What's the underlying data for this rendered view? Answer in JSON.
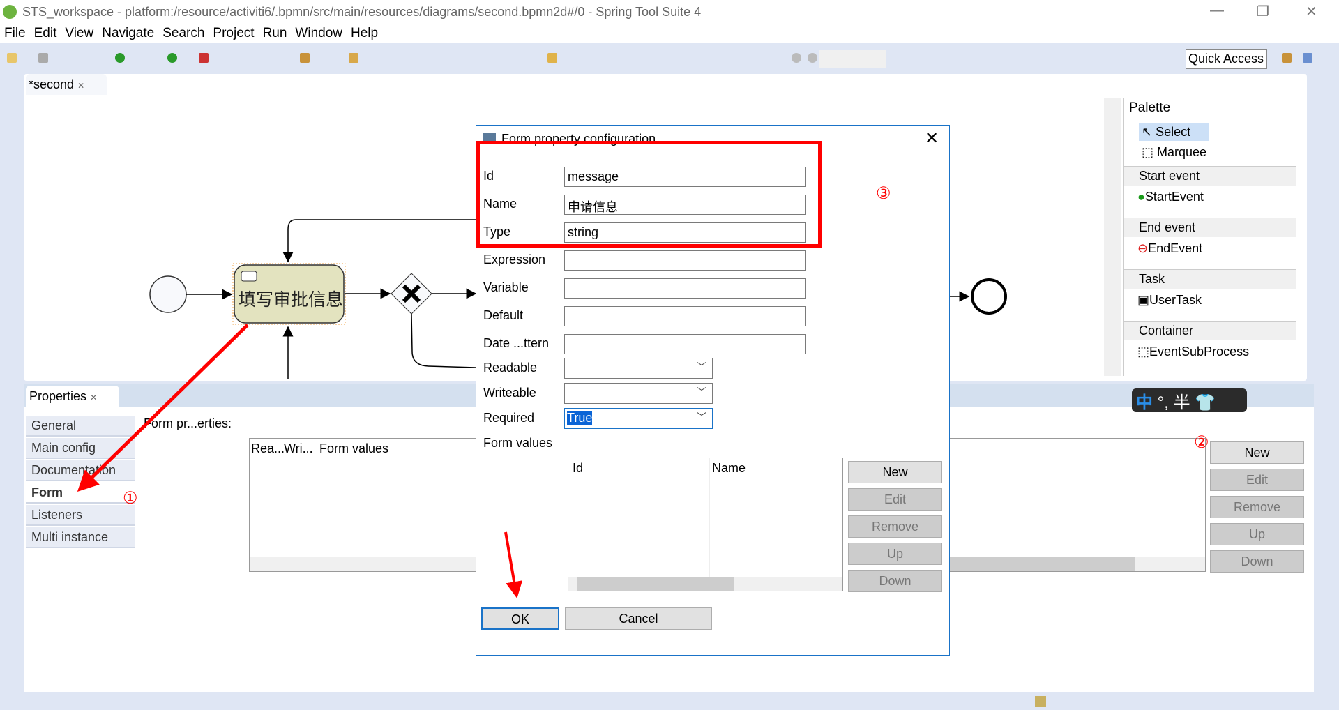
{
  "window": {
    "title": "STS_workspace - platform:/resource/activiti6/.bpmn/src/main/resources/diagrams/second.bpmn2d#/0 - Spring Tool Suite 4"
  },
  "menu": [
    "File",
    "Edit",
    "View",
    "Navigate",
    "Search",
    "Project",
    "Run",
    "Window",
    "Help"
  ],
  "toolbar": {
    "quick_access": "Quick Access"
  },
  "editor": {
    "tab_label": "*second",
    "task_label": "填写审批信息"
  },
  "palette": {
    "title": "Palette",
    "tools": [
      "Select",
      "Marquee"
    ],
    "groups": [
      {
        "name": "Start event",
        "item": "StartEvent"
      },
      {
        "name": "End event",
        "item": "EndEvent"
      },
      {
        "name": "Task",
        "item": "UserTask"
      },
      {
        "name": "Container",
        "item": "EventSubProcess"
      }
    ]
  },
  "properties": {
    "tab_label": "Properties",
    "tabs": [
      "General",
      "Main config",
      "Documentation",
      "Form",
      "Listeners",
      "Multi instance"
    ],
    "active_tab": "Form",
    "form_label": "Form pr...erties:",
    "columns": [
      "Rea...",
      "Wri...",
      "Form values"
    ],
    "buttons": [
      "New",
      "Edit",
      "Remove",
      "Up",
      "Down"
    ]
  },
  "dialog": {
    "title": "Form property configuration",
    "fields": [
      {
        "label": "Id",
        "value": "message"
      },
      {
        "label": "Name",
        "value": "申请信息"
      },
      {
        "label": "Type",
        "value": "string"
      },
      {
        "label": "Expression",
        "value": ""
      },
      {
        "label": "Variable",
        "value": ""
      },
      {
        "label": "Default",
        "value": ""
      },
      {
        "label": "Date ...ttern",
        "value": ""
      }
    ],
    "combos": [
      {
        "label": "Readable",
        "value": ""
      },
      {
        "label": "Writeable",
        "value": ""
      },
      {
        "label": "Required",
        "value": "True"
      }
    ],
    "form_values_label": "Form values",
    "columns": [
      "Id",
      "Name"
    ],
    "buttons": [
      "New",
      "Edit",
      "Remove",
      "Up",
      "Down"
    ],
    "ok": "OK",
    "cancel": "Cancel"
  },
  "annotations": {
    "one": "①",
    "two": "②",
    "three": "③"
  },
  "ime": {
    "mode": "中",
    "punct": "°,",
    "width": "半"
  },
  "colors": {
    "annotation": "#ff0000",
    "task_fill": "#e3e3bf",
    "accent": "#1a73c8"
  }
}
